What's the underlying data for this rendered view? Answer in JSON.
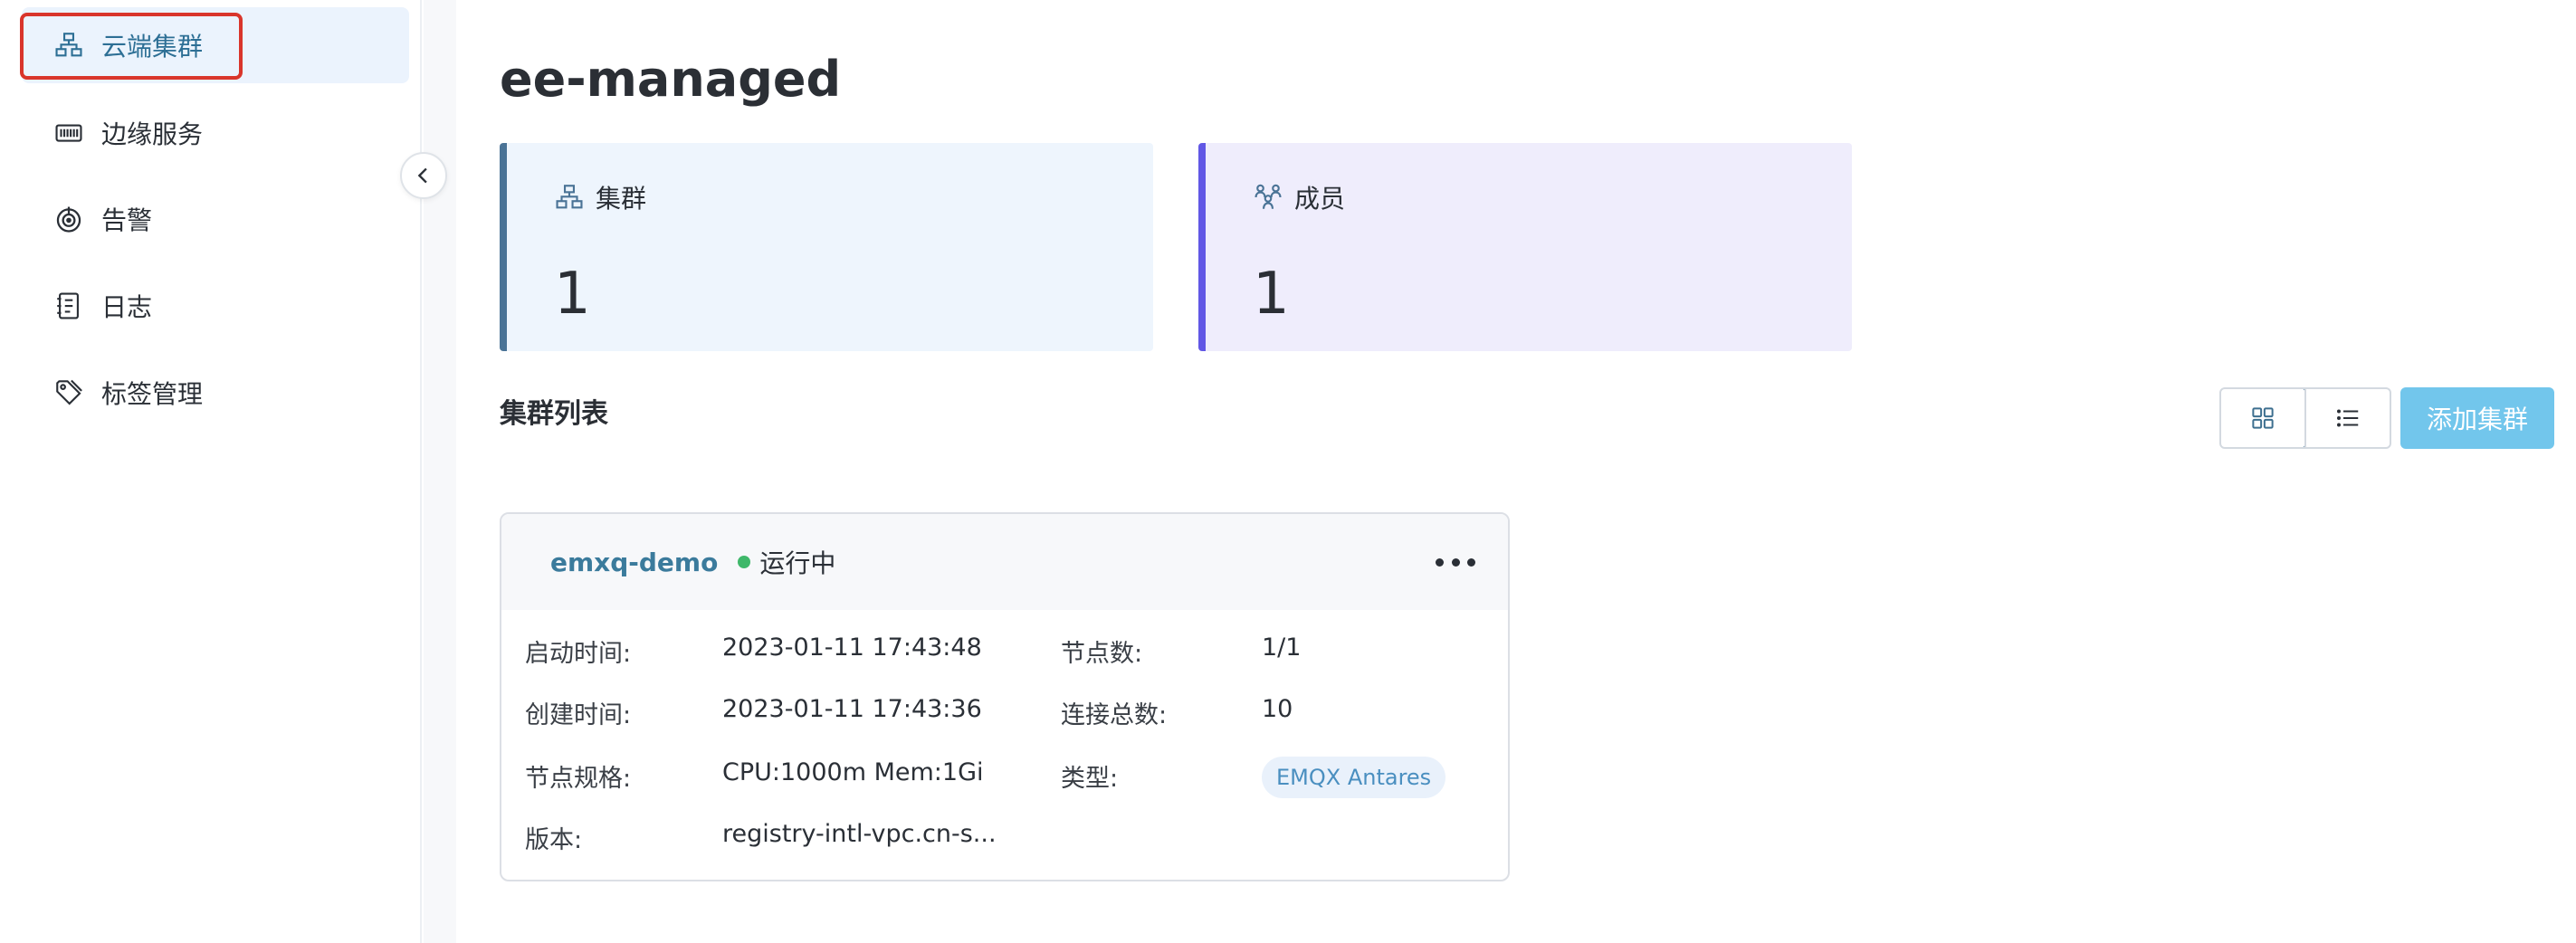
{
  "sidebar": {
    "items": [
      {
        "label": "云端集群",
        "icon": "cluster-icon",
        "active": true
      },
      {
        "label": "边缘服务",
        "icon": "edge-service-icon",
        "active": false
      },
      {
        "label": "告警",
        "icon": "alarm-icon",
        "active": false
      },
      {
        "label": "日志",
        "icon": "log-icon",
        "active": false
      },
      {
        "label": "标签管理",
        "icon": "tag-icon",
        "active": false
      }
    ]
  },
  "page": {
    "title": "ee-managed"
  },
  "stats": {
    "clusters": {
      "label": "集群",
      "value": "1",
      "accent": "#4a7396"
    },
    "members": {
      "label": "成员",
      "value": "1",
      "accent": "#6157e5"
    }
  },
  "cluster_list": {
    "title": "集群列表",
    "add_button": "添加集群",
    "view_modes": [
      "grid-icon",
      "list-icon"
    ]
  },
  "cluster": {
    "name": "emxq-demo",
    "status": "运行中",
    "status_color": "#3fb86a",
    "fields": {
      "start_time_label": "启动时间:",
      "start_time": "2023-01-11 17:43:48",
      "nodes_label": "节点数:",
      "nodes": "1/1",
      "created_label": "创建时间:",
      "created": "2023-01-11 17:43:36",
      "connections_label": "连接总数:",
      "connections": "10",
      "spec_label": "节点规格:",
      "spec": "CPU:1000m Mem:1Gi",
      "type_label": "类型:",
      "type": "EMQX Antares",
      "version_label": "版本:",
      "version": "registry-intl-vpc.cn-s..."
    }
  },
  "colors": {
    "link": "#3b7b9c",
    "add_button": "#72c6ec",
    "active_nav_bg": "#ebf3fd",
    "highlight": "#d9352b"
  }
}
